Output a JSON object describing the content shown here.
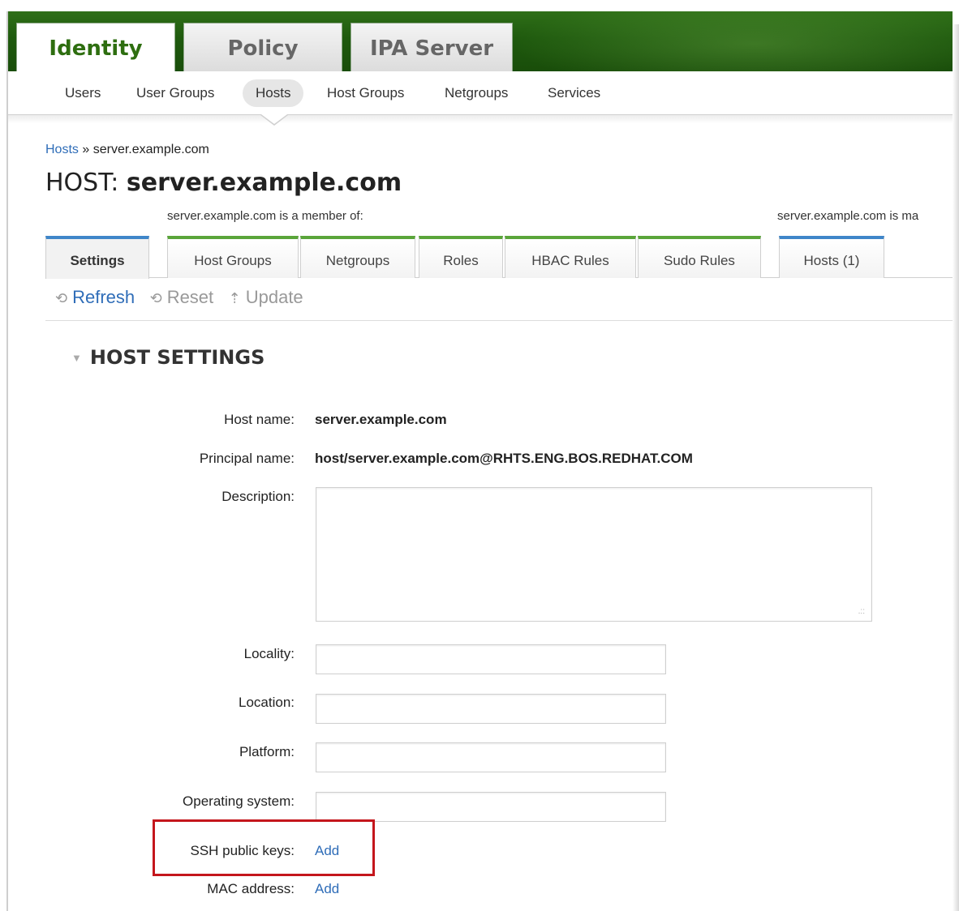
{
  "main_tabs": [
    {
      "label": "Identity",
      "active": true
    },
    {
      "label": "Policy",
      "active": false
    },
    {
      "label": "IPA Server",
      "active": false
    }
  ],
  "subnav": [
    {
      "label": "Users",
      "active": false
    },
    {
      "label": "User Groups",
      "active": false
    },
    {
      "label": "Hosts",
      "active": true
    },
    {
      "label": "Host Groups",
      "active": false
    },
    {
      "label": "Netgroups",
      "active": false
    },
    {
      "label": "Services",
      "active": false
    }
  ],
  "breadcrumb": {
    "link": "Hosts",
    "separator": "»",
    "current": "server.example.com"
  },
  "title": {
    "prefix": "HOST:",
    "name": "server.example.com"
  },
  "member_of_label": "server.example.com is a member of:",
  "managed_by_label": "server.example.com is ma",
  "facets": [
    {
      "label": "Settings",
      "active": true,
      "group": "blue"
    },
    {
      "label": "Host Groups",
      "active": false,
      "group": "green"
    },
    {
      "label": "Netgroups",
      "active": false,
      "group": "green"
    },
    {
      "label": "Roles",
      "active": false,
      "group": "green"
    },
    {
      "label": "HBAC Rules",
      "active": false,
      "group": "green"
    },
    {
      "label": "Sudo Rules",
      "active": false,
      "group": "green"
    },
    {
      "label": "Hosts (1)",
      "active": false,
      "group": "blue"
    }
  ],
  "actions": [
    {
      "label": "Refresh",
      "icon": "refresh-icon",
      "enabled": true
    },
    {
      "label": "Reset",
      "icon": "reset-icon",
      "enabled": false
    },
    {
      "label": "Update",
      "icon": "update-icon",
      "enabled": false
    }
  ],
  "section": {
    "title": "HOST SETTINGS"
  },
  "fields": {
    "host_name": {
      "label": "Host name:",
      "value": "server.example.com"
    },
    "principal_name": {
      "label": "Principal name:",
      "value": "host/server.example.com@RHTS.ENG.BOS.REDHAT.COM"
    },
    "description": {
      "label": "Description:",
      "value": ""
    },
    "locality": {
      "label": "Locality:",
      "value": ""
    },
    "location": {
      "label": "Location:",
      "value": ""
    },
    "platform": {
      "label": "Platform:",
      "value": ""
    },
    "operating_system": {
      "label": "Operating system:",
      "value": ""
    },
    "ssh_public_keys": {
      "label": "SSH public keys:",
      "link": "Add"
    },
    "mac_address": {
      "label": "MAC address:",
      "link": "Add"
    }
  },
  "colors": {
    "header_green": "#1f5a0e",
    "active_tab_text": "#2e6e10",
    "link_blue": "#2f6db8",
    "highlight_red": "#c4161c"
  }
}
